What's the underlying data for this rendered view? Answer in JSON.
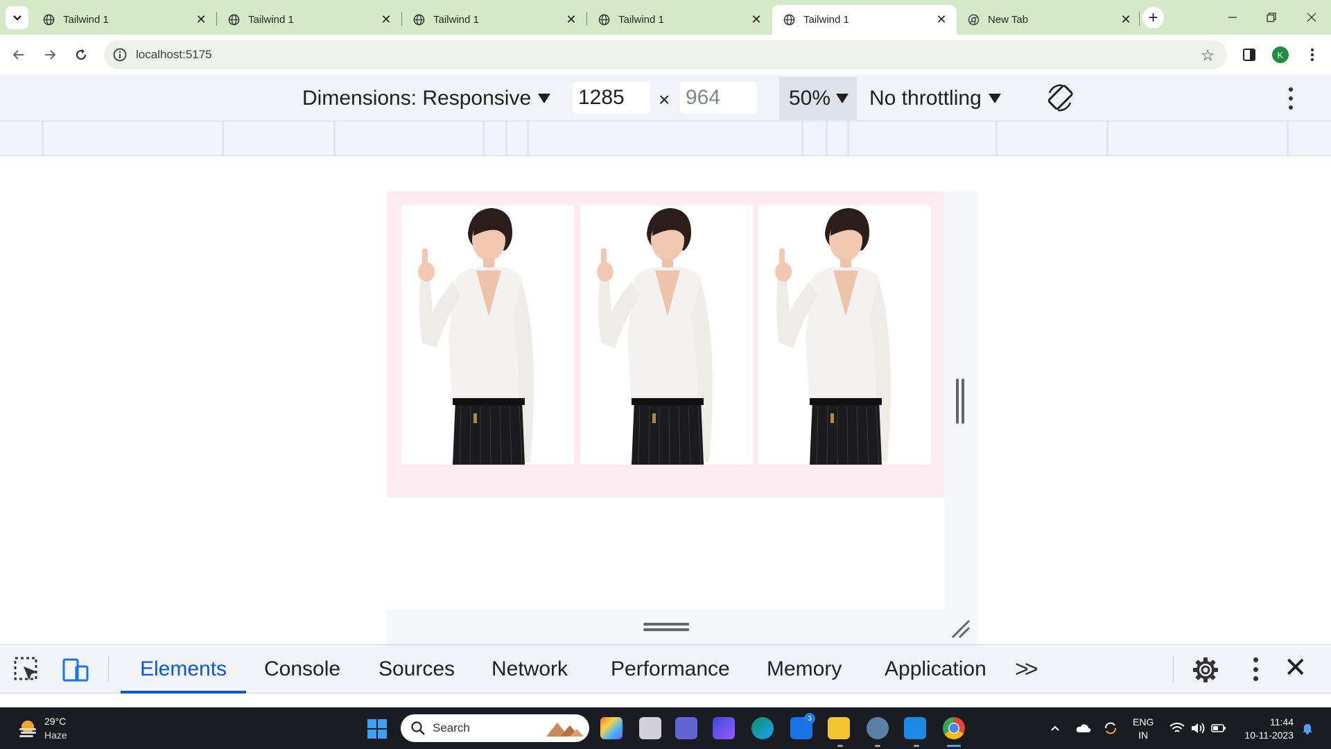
{
  "tabs": [
    {
      "title": "Tailwind 1",
      "active": false
    },
    {
      "title": "Tailwind 1",
      "active": false
    },
    {
      "title": "Tailwind 1",
      "active": false
    },
    {
      "title": "Tailwind 1",
      "active": false
    },
    {
      "title": "Tailwind 1",
      "active": true
    },
    {
      "title": "New Tab",
      "active": false
    }
  ],
  "address_bar": {
    "url": "localhost:5175"
  },
  "profile": {
    "initial": "K"
  },
  "device_toolbar": {
    "dimensions_label": "Dimensions: Responsive",
    "width_value": "1285",
    "height_value": "964",
    "times_symbol": "×",
    "zoom": "50%",
    "throttling": "No throttling"
  },
  "page": {
    "background_color": "#fdebf1",
    "images": [
      {
        "alt": "woman-pointing-up-photo"
      },
      {
        "alt": "woman-pointing-up-photo"
      },
      {
        "alt": "woman-pointing-up-photo"
      }
    ]
  },
  "devtools": {
    "tabs": [
      "Elements",
      "Console",
      "Sources",
      "Network",
      "Performance",
      "Memory",
      "Application"
    ],
    "active_tab": "Elements",
    "accent_color": "#0b57d0"
  },
  "taskbar": {
    "weather_temp": "29°C",
    "weather_condition": "Haze",
    "search_placeholder": "Search",
    "mail_badge": "3",
    "language": "ENG",
    "region": "IN",
    "time": "11:44",
    "date": "10-11-2023"
  }
}
